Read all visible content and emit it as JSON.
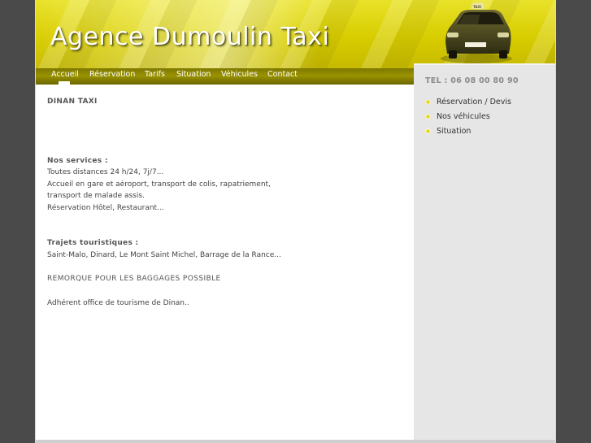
{
  "header": {
    "site_title": "Agence Dumoulin Taxi",
    "taxi_sign_text": "TAXI"
  },
  "nav": {
    "items": [
      {
        "label": "Accueil",
        "active": true
      },
      {
        "label": "Réservation"
      },
      {
        "label": "Tarifs"
      },
      {
        "label": "Situation"
      },
      {
        "label": "Véhicules"
      },
      {
        "label": "Contact"
      }
    ]
  },
  "main": {
    "title": "DINAN TAXI",
    "services_heading": "Nos services :",
    "services_lines": [
      "Toutes distances 24 h/24, 7j/7...",
      "Accueil en gare et aéroport, transport de colis, rapatriement,",
      "transport de malade assis.",
      "Réservation Hôtel, Restaurant..."
    ],
    "trips_heading": "Trajets touristiques :",
    "trips_line": "Saint-Malo, Dinard, Le Mont Saint Michel, Barrage de la Rance...",
    "trailer_note": "REMORQUE POUR LES BAGGAGES POSSIBLE",
    "tourism_note": "Adhérent office de tourisme de Dinan.."
  },
  "sidebar": {
    "phone": "TEL : 06 08 00 80 90",
    "links": [
      {
        "label": "Réservation / Devis"
      },
      {
        "label": "Nos véhicules"
      },
      {
        "label": "Situation"
      }
    ]
  },
  "colors": {
    "header_yellow": "#d8cd00",
    "nav_olive": "#8a8400",
    "sidebar_grey": "#e6e6e6",
    "bullet_yellow": "#e8d800"
  }
}
